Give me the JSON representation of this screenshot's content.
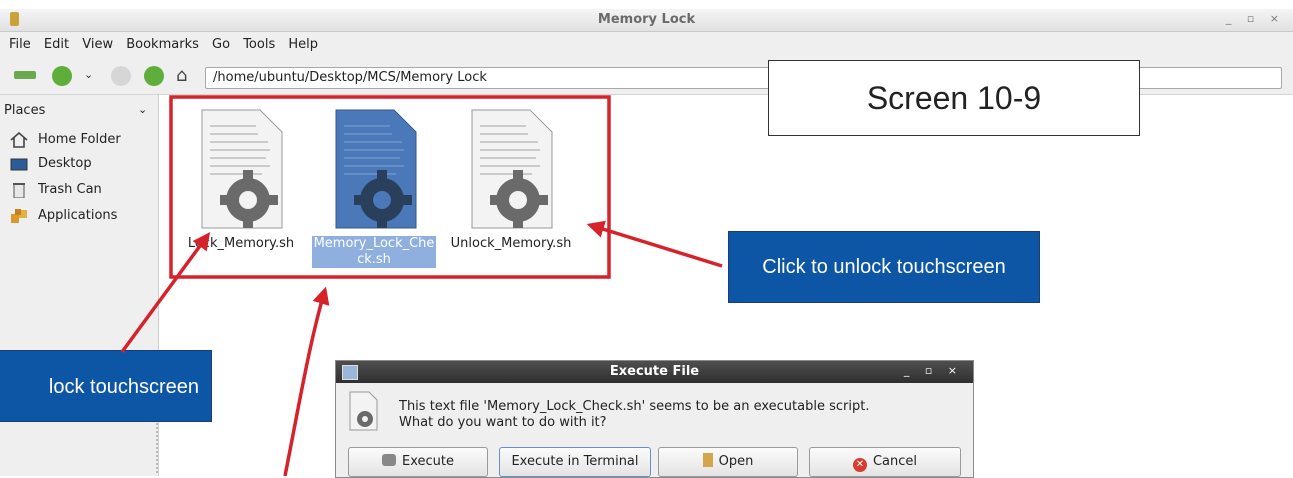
{
  "window": {
    "title": "Memory Lock",
    "controls": "_ ▫ ×"
  },
  "menubar": [
    "File",
    "Edit",
    "View",
    "Bookmarks",
    "Go",
    "Tools",
    "Help"
  ],
  "toolbar": {
    "path": "/home/ubuntu/Desktop/MCS/Memory Lock"
  },
  "sidebar": {
    "header": "Places",
    "items": [
      {
        "label": "Home Folder",
        "icon": "home-icon"
      },
      {
        "label": "Desktop",
        "icon": "desktop-icon"
      },
      {
        "label": "Trash Can",
        "icon": "trash-icon"
      },
      {
        "label": "Applications",
        "icon": "applications-icon"
      }
    ]
  },
  "files": [
    {
      "name": "Lock_Memory.sh",
      "display": "Lock_Memory.sh",
      "selected": false
    },
    {
      "name": "Memory_Lock_Check.sh",
      "display_line1": "Memory_Lock_Che",
      "display_line2": "ck.sh",
      "selected": true
    },
    {
      "name": "Unlock_Memory.sh",
      "display": "Unlock_Memory.sh",
      "selected": false
    }
  ],
  "dialog": {
    "title": "Execute File",
    "controls": "_ ▫ ×",
    "message_line1": "This text file 'Memory_Lock_Check.sh' seems to be an executable script.",
    "message_line2": "What do you want to do with it?",
    "buttons": {
      "execute": "Execute",
      "terminal": "Execute in Terminal",
      "open": "Open",
      "cancel": "Cancel"
    }
  },
  "annotations": {
    "screen_label": "Screen 10-9",
    "unlock_callout": "Click to unlock touchscreen",
    "lock_callout": "lock touchscreen"
  },
  "colors": {
    "callout_bg": "#0d56a5",
    "arrow": "#d6222b",
    "selection": "#4a78b8"
  }
}
